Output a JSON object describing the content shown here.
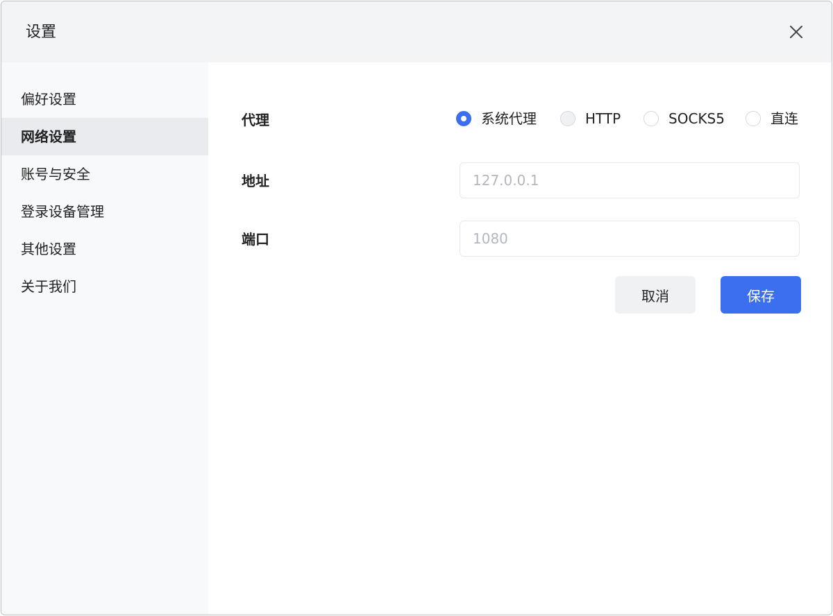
{
  "dialog": {
    "title": "设置"
  },
  "sidebar": {
    "items": [
      {
        "label": "偏好设置"
      },
      {
        "label": "网络设置"
      },
      {
        "label": "账号与安全"
      },
      {
        "label": "登录设备管理"
      },
      {
        "label": "其他设置"
      },
      {
        "label": "关于我们"
      }
    ],
    "active_label": "网络设置"
  },
  "form": {
    "proxy_label": "代理",
    "proxy_options": [
      {
        "label": "系统代理"
      },
      {
        "label": "HTTP"
      },
      {
        "label": "SOCKS5"
      },
      {
        "label": "直连"
      }
    ],
    "proxy_selected": "系统代理",
    "address_label": "地址",
    "address_placeholder": "127.0.0.1",
    "address_value": "",
    "port_label": "端口",
    "port_placeholder": "1080",
    "port_value": "",
    "cancel_label": "取消",
    "save_label": "保存"
  },
  "colors": {
    "accent": "#3b6ff0",
    "title_bar": "#f3f4f6",
    "sidebar": "#f8f9fb",
    "sidebar_active": "#e9ebee"
  },
  "icons": {
    "close": "close-icon"
  }
}
